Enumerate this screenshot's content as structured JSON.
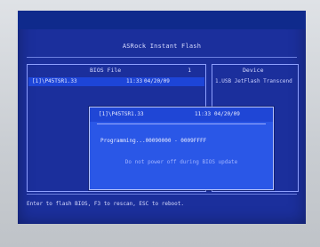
{
  "app": {
    "title": "ASRock Instant Flash"
  },
  "file_panel": {
    "header": "BIOS File",
    "count": "1",
    "files": [
      {
        "name": "[1]\\P45TSR1.33",
        "time": "11:33",
        "date": "04/20/09"
      }
    ]
  },
  "device_panel": {
    "header": "Device",
    "device": "1.USB JetFlash Transcend"
  },
  "dialog": {
    "file": "[1]\\P45TSR1.33",
    "time": "11:33",
    "date": "04/20/09",
    "progress_text": "Programming...00090000 - 0009FFFF",
    "warning": "Do not power off during BIOS update"
  },
  "footer": {
    "hint": "Enter to flash BIOS, F3 to rescan, ESC to reboot."
  }
}
